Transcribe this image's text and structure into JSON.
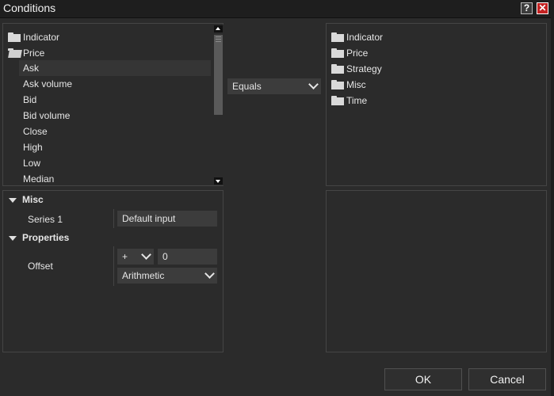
{
  "window": {
    "title": "Conditions",
    "help_label": "?",
    "close_label": "✕"
  },
  "left_tree": {
    "folders": [
      {
        "label": "Indicator",
        "icon": "folder-closed-icon"
      },
      {
        "label": "Price",
        "icon": "folder-open-icon"
      }
    ],
    "price_items": [
      "Ask",
      "Ask volume",
      "Bid",
      "Bid volume",
      "Close",
      "High",
      "Low",
      "Median"
    ],
    "selected": "Ask"
  },
  "operator": {
    "value": "Equals"
  },
  "right_tree": {
    "folders": [
      "Indicator",
      "Price",
      "Strategy",
      "Misc",
      "Time"
    ]
  },
  "properties": {
    "misc": {
      "label": "Misc",
      "series_label": "Series 1",
      "series_value": "Default input"
    },
    "props": {
      "label": "Properties",
      "offset_label": "Offset",
      "offset_sign": "+",
      "offset_value": "0",
      "offset_type": "Arithmetic"
    }
  },
  "buttons": {
    "ok": "OK",
    "cancel": "Cancel"
  },
  "colors": {
    "background": "#2b2b2b",
    "panel_border": "#454545",
    "field": "#3c3c3c",
    "close": "#c32222",
    "accent_edge": "#c89a1e"
  }
}
